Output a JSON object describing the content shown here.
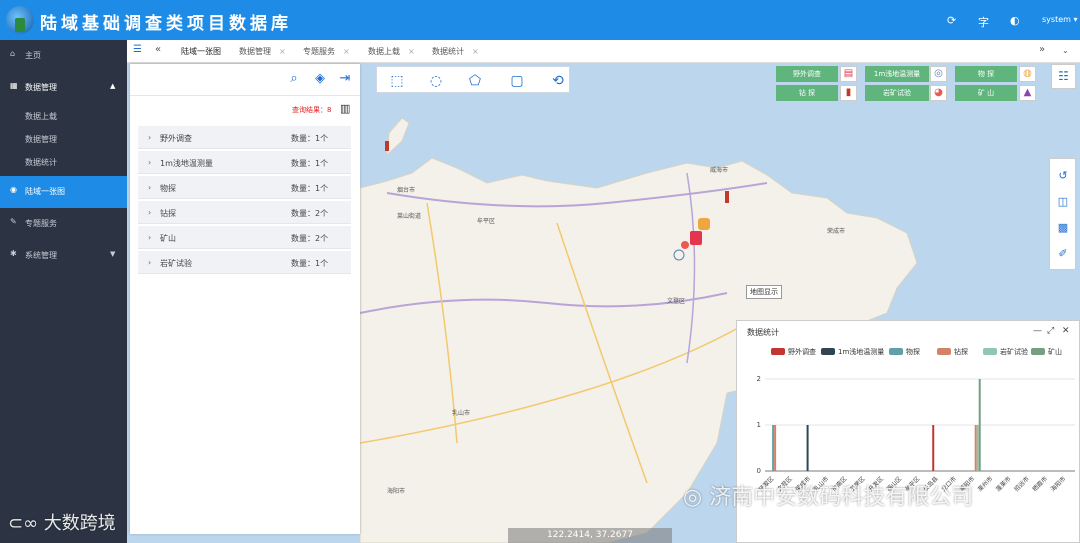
{
  "app": {
    "title": "陆域基础调查类项目数据库",
    "user": "system"
  },
  "sidebar": {
    "items": [
      {
        "label": "主页",
        "icon": "home-icon"
      },
      {
        "label": "数据管理",
        "icon": "grid-icon"
      },
      {
        "label": "陆域一张图",
        "icon": "globe-icon"
      },
      {
        "label": "专题服务",
        "icon": "edit-icon"
      },
      {
        "label": "系统管理",
        "icon": "gear-icon"
      }
    ],
    "subitems": [
      "数据上载",
      "数据管理",
      "数据统计"
    ]
  },
  "tabs": [
    {
      "label": "陆域一张图"
    },
    {
      "label": "数据管理"
    },
    {
      "label": "专题服务"
    },
    {
      "label": "数据上载"
    },
    {
      "label": "数据统计"
    }
  ],
  "panel": {
    "result_label": "查询结果：8",
    "rows": [
      {
        "name": "野外调查",
        "count": "数量：1个"
      },
      {
        "name": "1m浅地温测量",
        "count": "数量：1个"
      },
      {
        "name": "物探",
        "count": "数量：1个"
      },
      {
        "name": "钻探",
        "count": "数量：2个"
      },
      {
        "name": "矿山",
        "count": "数量：2个"
      },
      {
        "name": "岩矿试验",
        "count": "数量：1个"
      }
    ]
  },
  "legend": {
    "buttons": [
      {
        "label": "野外调查",
        "color": "#5fb57c"
      },
      {
        "label": "1m浅地温测量",
        "color": "#5fb57c"
      },
      {
        "label": "物 探",
        "color": "#5fb57c"
      },
      {
        "label": "钻 探",
        "color": "#5fb57c"
      },
      {
        "label": "岩矿试验",
        "color": "#5fb57c"
      },
      {
        "label": "矿 山",
        "color": "#5fb57c"
      }
    ]
  },
  "map": {
    "tooltip": "地图显示",
    "coordinates": "122.2414, 37.2677",
    "labels": [
      "烟台市",
      "威海市",
      "牟平区",
      "文登区",
      "乳山市",
      "海阳市",
      "荣成市",
      "莱山街道"
    ]
  },
  "stats": {
    "title": "数据统计"
  },
  "chart_data": {
    "type": "bar",
    "title": "",
    "xlabel": "",
    "ylabel": "",
    "ylim": [
      0,
      2
    ],
    "yticks": [
      0,
      1,
      2
    ],
    "series": [
      {
        "name": "野外调查",
        "color": "#c23531",
        "values": [
          0,
          0,
          0,
          0,
          0,
          0,
          0,
          0,
          0,
          1,
          0,
          0,
          0,
          0,
          0,
          0,
          0
        ]
      },
      {
        "name": "1m浅地温测量",
        "color": "#2f4554",
        "values": [
          0,
          0,
          1,
          0,
          0,
          0,
          0,
          0,
          0,
          0,
          0,
          0,
          0,
          0,
          0,
          0,
          0
        ]
      },
      {
        "name": "物探",
        "color": "#61a0a8",
        "values": [
          1,
          0,
          0,
          0,
          0,
          0,
          0,
          0,
          0,
          0,
          0,
          0,
          0,
          0,
          0,
          0,
          0
        ]
      },
      {
        "name": "钻探",
        "color": "#d48265",
        "values": [
          1,
          0,
          0,
          0,
          0,
          0,
          0,
          0,
          0,
          0,
          0,
          1,
          0,
          0,
          0,
          0,
          0
        ]
      },
      {
        "name": "岩矿试验",
        "color": "#91c7ae",
        "values": [
          0,
          0,
          0,
          0,
          0,
          0,
          0,
          0,
          0,
          0,
          0,
          1,
          0,
          0,
          0,
          0,
          0
        ]
      },
      {
        "name": "矿山",
        "color": "#749f83",
        "values": [
          0,
          0,
          0,
          0,
          0,
          0,
          0,
          0,
          0,
          0,
          0,
          2,
          0,
          0,
          0,
          0,
          0
        ]
      }
    ],
    "categories": [
      "环翠区",
      "文登区",
      "荣成市",
      "乳山市",
      "市南区",
      "芝罘区",
      "开发区",
      "福山区",
      "牟平区",
      "长岛县",
      "龙口市",
      "莱阳市",
      "莱州市",
      "蓬莱市",
      "招远市",
      "栖霞市",
      "海阳市"
    ]
  }
}
